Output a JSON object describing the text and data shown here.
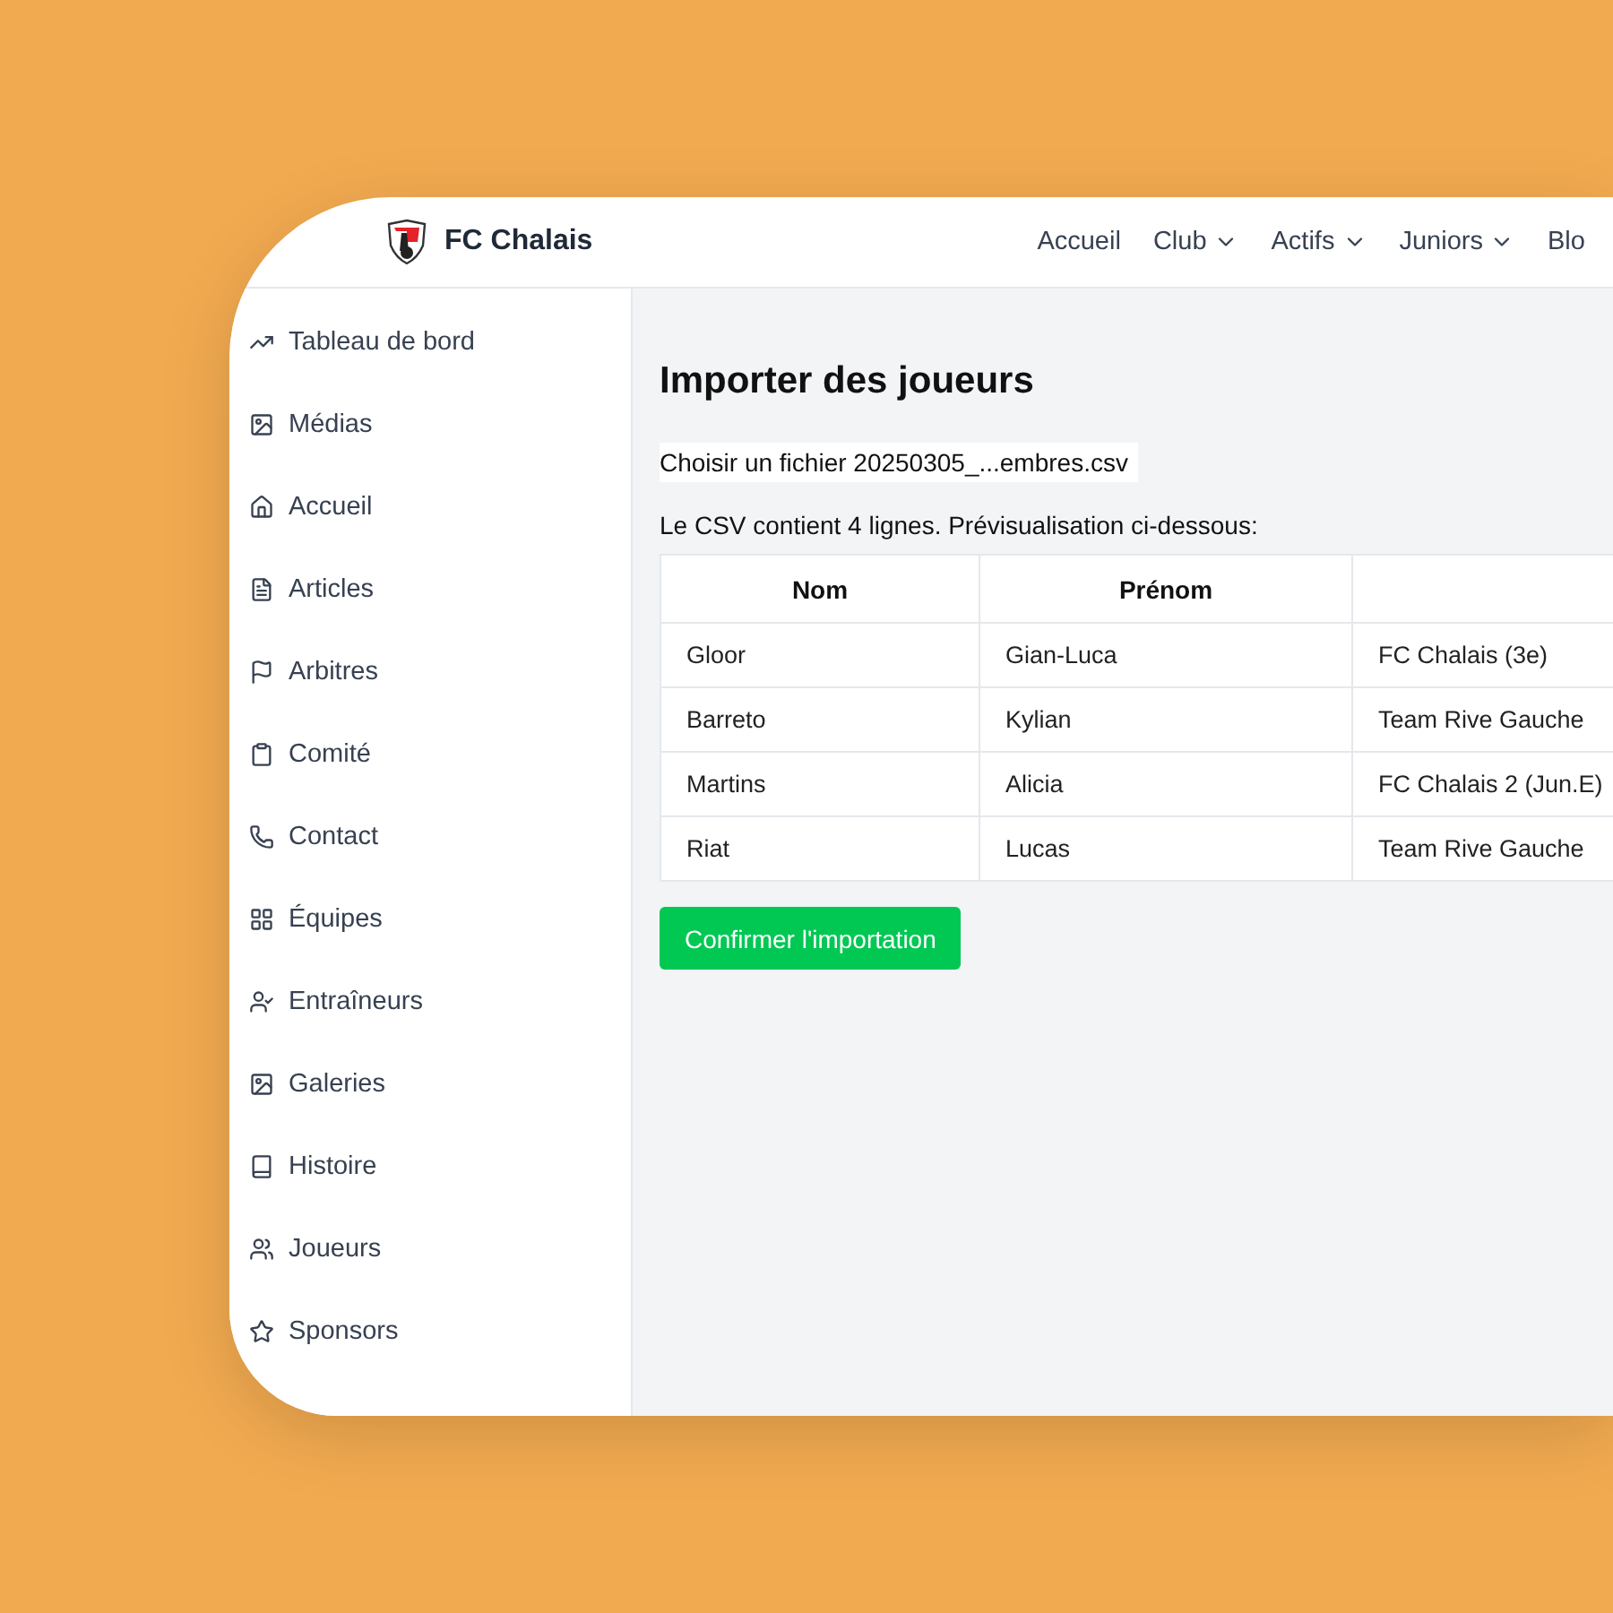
{
  "header": {
    "brand": "FC Chalais",
    "nav": [
      {
        "label": "Accueil",
        "dropdown": false
      },
      {
        "label": "Club",
        "dropdown": true
      },
      {
        "label": "Actifs",
        "dropdown": true
      },
      {
        "label": "Juniors",
        "dropdown": true
      },
      {
        "label": "Blo",
        "dropdown": false
      }
    ]
  },
  "sidebar": {
    "items": [
      {
        "label": "Tableau de bord"
      },
      {
        "label": "Médias"
      },
      {
        "label": "Accueil"
      },
      {
        "label": "Articles"
      },
      {
        "label": "Arbitres"
      },
      {
        "label": "Comité"
      },
      {
        "label": "Contact"
      },
      {
        "label": "Équipes"
      },
      {
        "label": "Entraîneurs"
      },
      {
        "label": "Galeries"
      },
      {
        "label": "Histoire"
      },
      {
        "label": "Joueurs"
      },
      {
        "label": "Sponsors"
      }
    ]
  },
  "main": {
    "title": "Importer des joueurs",
    "file_input": "Choisir un fichier 20250305_...embres.csv",
    "summary": "Le CSV contient 4 lignes. Prévisualisation ci-dessous:",
    "table": {
      "columns": [
        "Nom",
        "Prénom",
        ""
      ],
      "rows": [
        [
          "Gloor",
          "Gian-Luca",
          "FC Chalais (3e)"
        ],
        [
          "Barreto",
          "Kylian",
          "Team Rive Gauche"
        ],
        [
          "Martins",
          "Alicia",
          "FC Chalais 2 (Jun.E)"
        ],
        [
          "Riat",
          "Lucas",
          "Team Rive Gauche"
        ]
      ]
    },
    "confirm_button": "Confirmer l'importation"
  }
}
